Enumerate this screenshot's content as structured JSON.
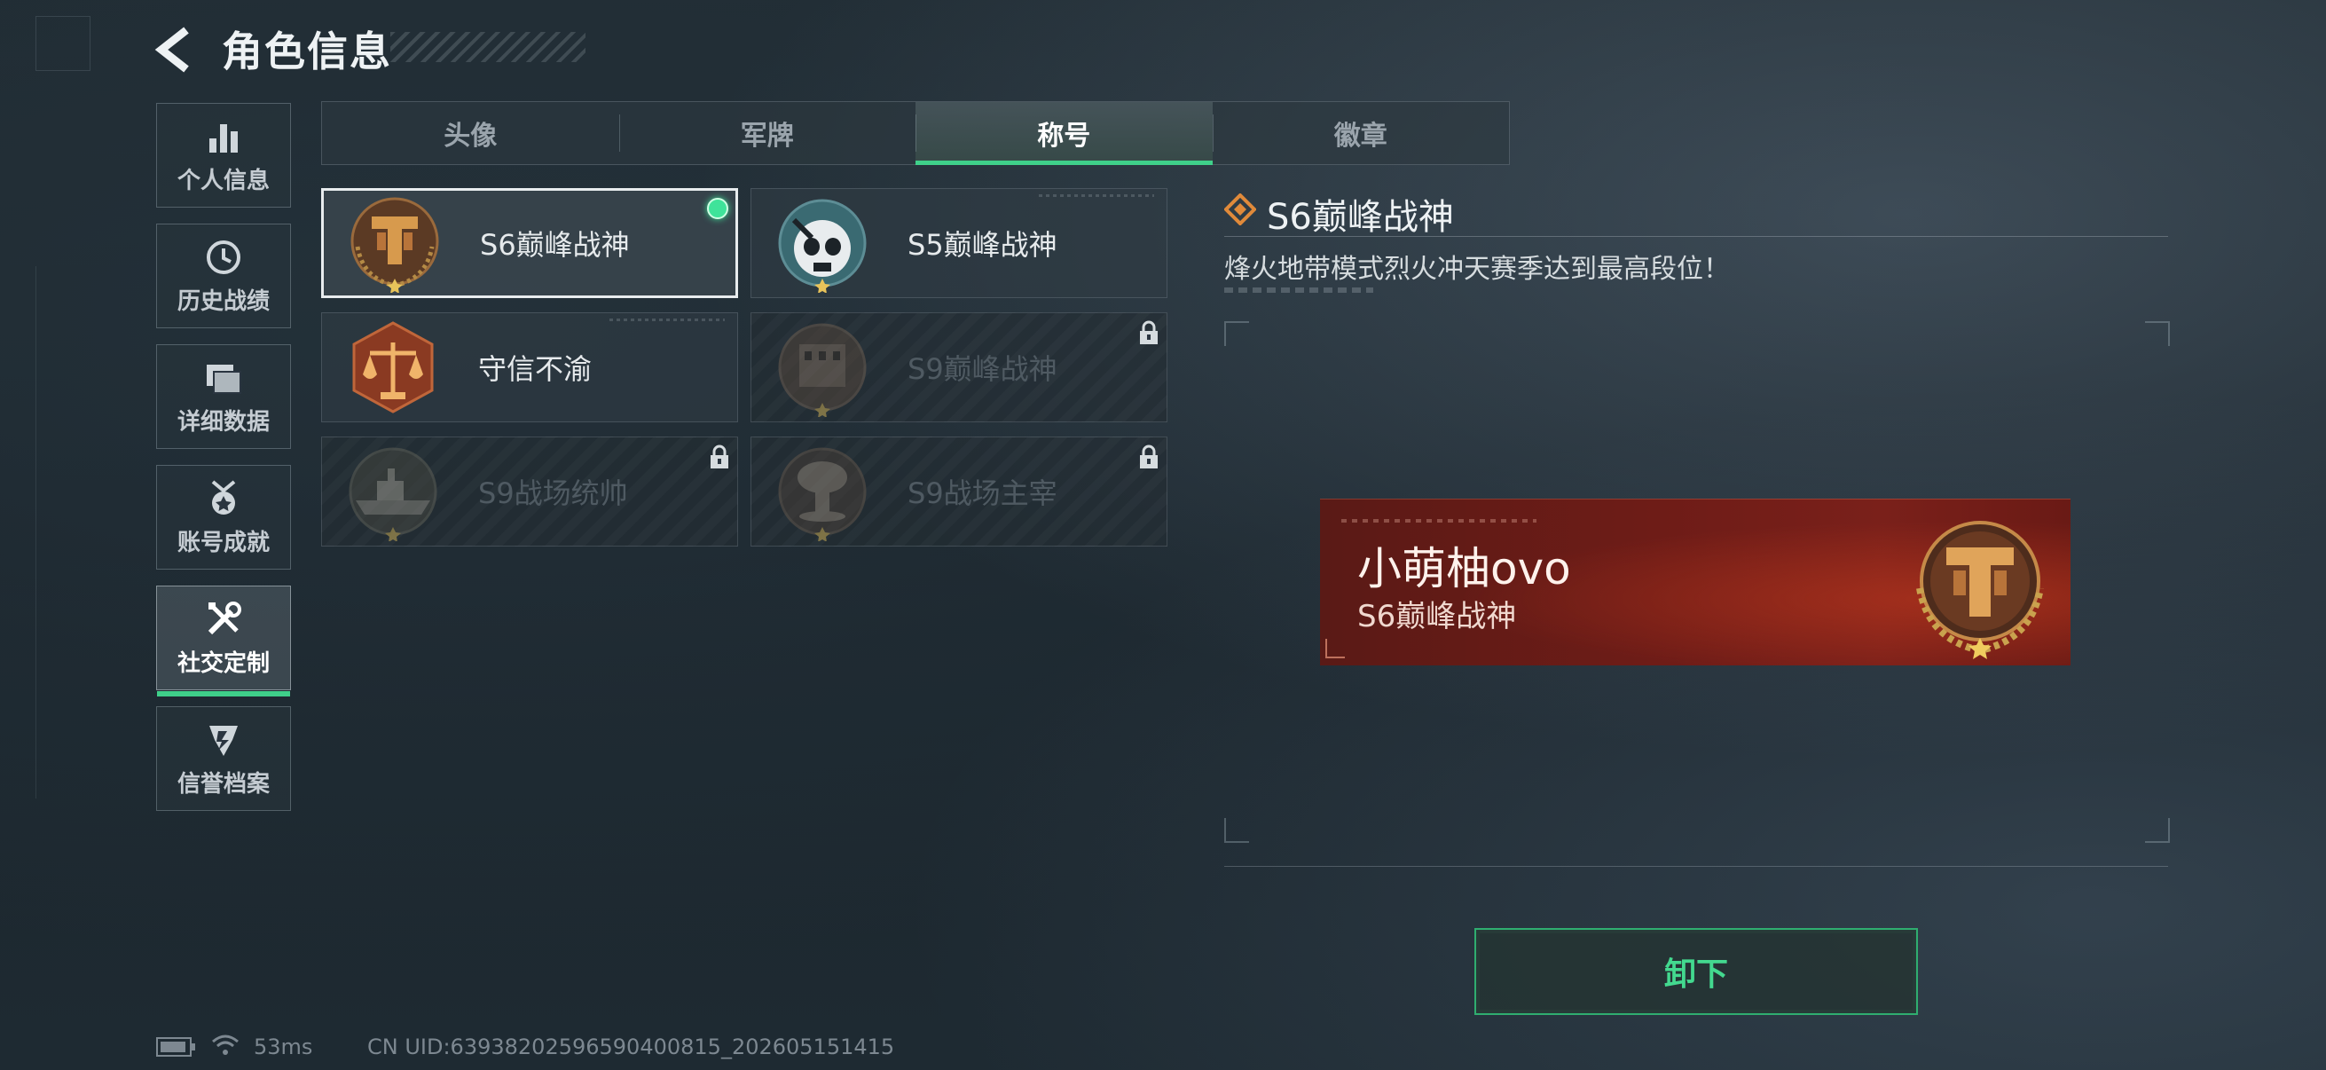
{
  "header": {
    "title": "角色信息"
  },
  "sidebar": {
    "items": [
      {
        "label": "个人信息",
        "icon": "bar-chart-icon"
      },
      {
        "label": "历史战绩",
        "icon": "clock-icon"
      },
      {
        "label": "详细数据",
        "icon": "folder-icon"
      },
      {
        "label": "账号成就",
        "icon": "medal-icon"
      },
      {
        "label": "社交定制",
        "icon": "tools-icon",
        "active": true
      },
      {
        "label": "信誉档案",
        "icon": "shield-icon"
      }
    ]
  },
  "tabs": [
    {
      "label": "头像"
    },
    {
      "label": "军牌"
    },
    {
      "label": "称号",
      "active": true
    },
    {
      "label": "徽章"
    }
  ],
  "titles": [
    {
      "name": "S6巅峰战神",
      "emblem": "bronze-t-emblem",
      "selected": true,
      "equipped": true,
      "locked": false
    },
    {
      "name": "S5巅峰战神",
      "emblem": "skull-diver-emblem",
      "selected": false,
      "locked": false
    },
    {
      "name": "守信不渝",
      "emblem": "scales-emblem",
      "selected": false,
      "locked": false
    },
    {
      "name": "S9巅峰战神",
      "emblem": "building-emblem",
      "selected": false,
      "locked": true
    },
    {
      "name": "S9战场统帅",
      "emblem": "warship-emblem",
      "selected": false,
      "locked": true
    },
    {
      "name": "S9战场主宰",
      "emblem": "mushroom-cloud-emblem",
      "selected": false,
      "locked": true
    }
  ],
  "detail": {
    "title": "S6巅峰战神",
    "description": "烽火地带模式烈火冲天赛季达到最高段位！"
  },
  "preview": {
    "player_name": "小萌柚ovo",
    "title": "S6巅峰战神"
  },
  "action": {
    "unequip_label": "卸下"
  },
  "status_bar": {
    "ping": "53ms",
    "uid": "CN UID:6393820259659040081​5_202605151415"
  },
  "colors": {
    "accent": "#3fd08a",
    "banner_red": "#6e1c17",
    "bronze": "#b8743a"
  }
}
